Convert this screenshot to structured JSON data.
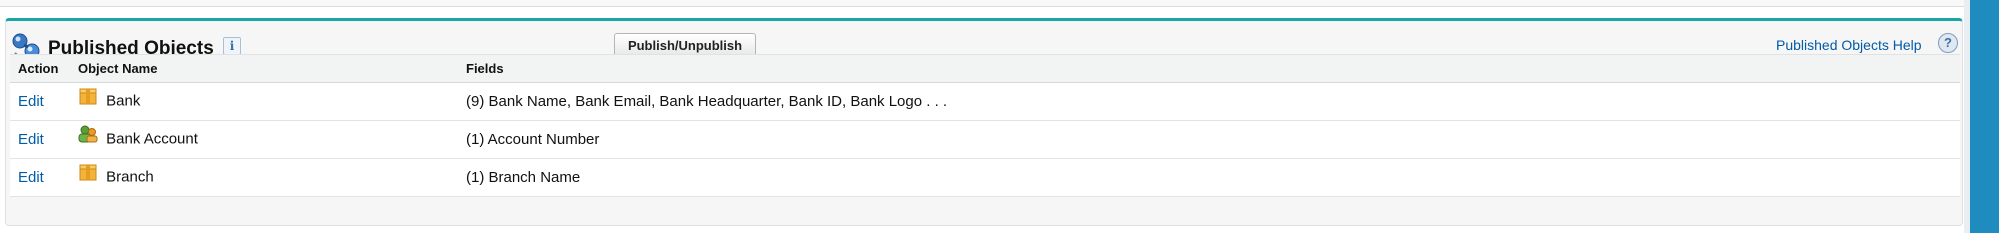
{
  "panel": {
    "title": "Published Objects",
    "info_icon": "i",
    "publish_button": "Publish/Unpublish",
    "help_link": "Published Objects Help",
    "help_icon": "?",
    "accent_color": "#1aa6a8"
  },
  "table": {
    "headers": {
      "action": "Action",
      "object_name": "Object Name",
      "fields": "Fields"
    },
    "rows": [
      {
        "action": "Edit",
        "icon": "box-icon",
        "name": "Bank",
        "fields": "(9) Bank Name, Bank Email, Bank Headquarter, Bank ID, Bank Logo . . ."
      },
      {
        "action": "Edit",
        "icon": "people-icon",
        "name": "Bank Account",
        "fields": "(1) Account Number"
      },
      {
        "action": "Edit",
        "icon": "box-icon",
        "name": "Branch",
        "fields": "(1) Branch Name"
      }
    ]
  }
}
